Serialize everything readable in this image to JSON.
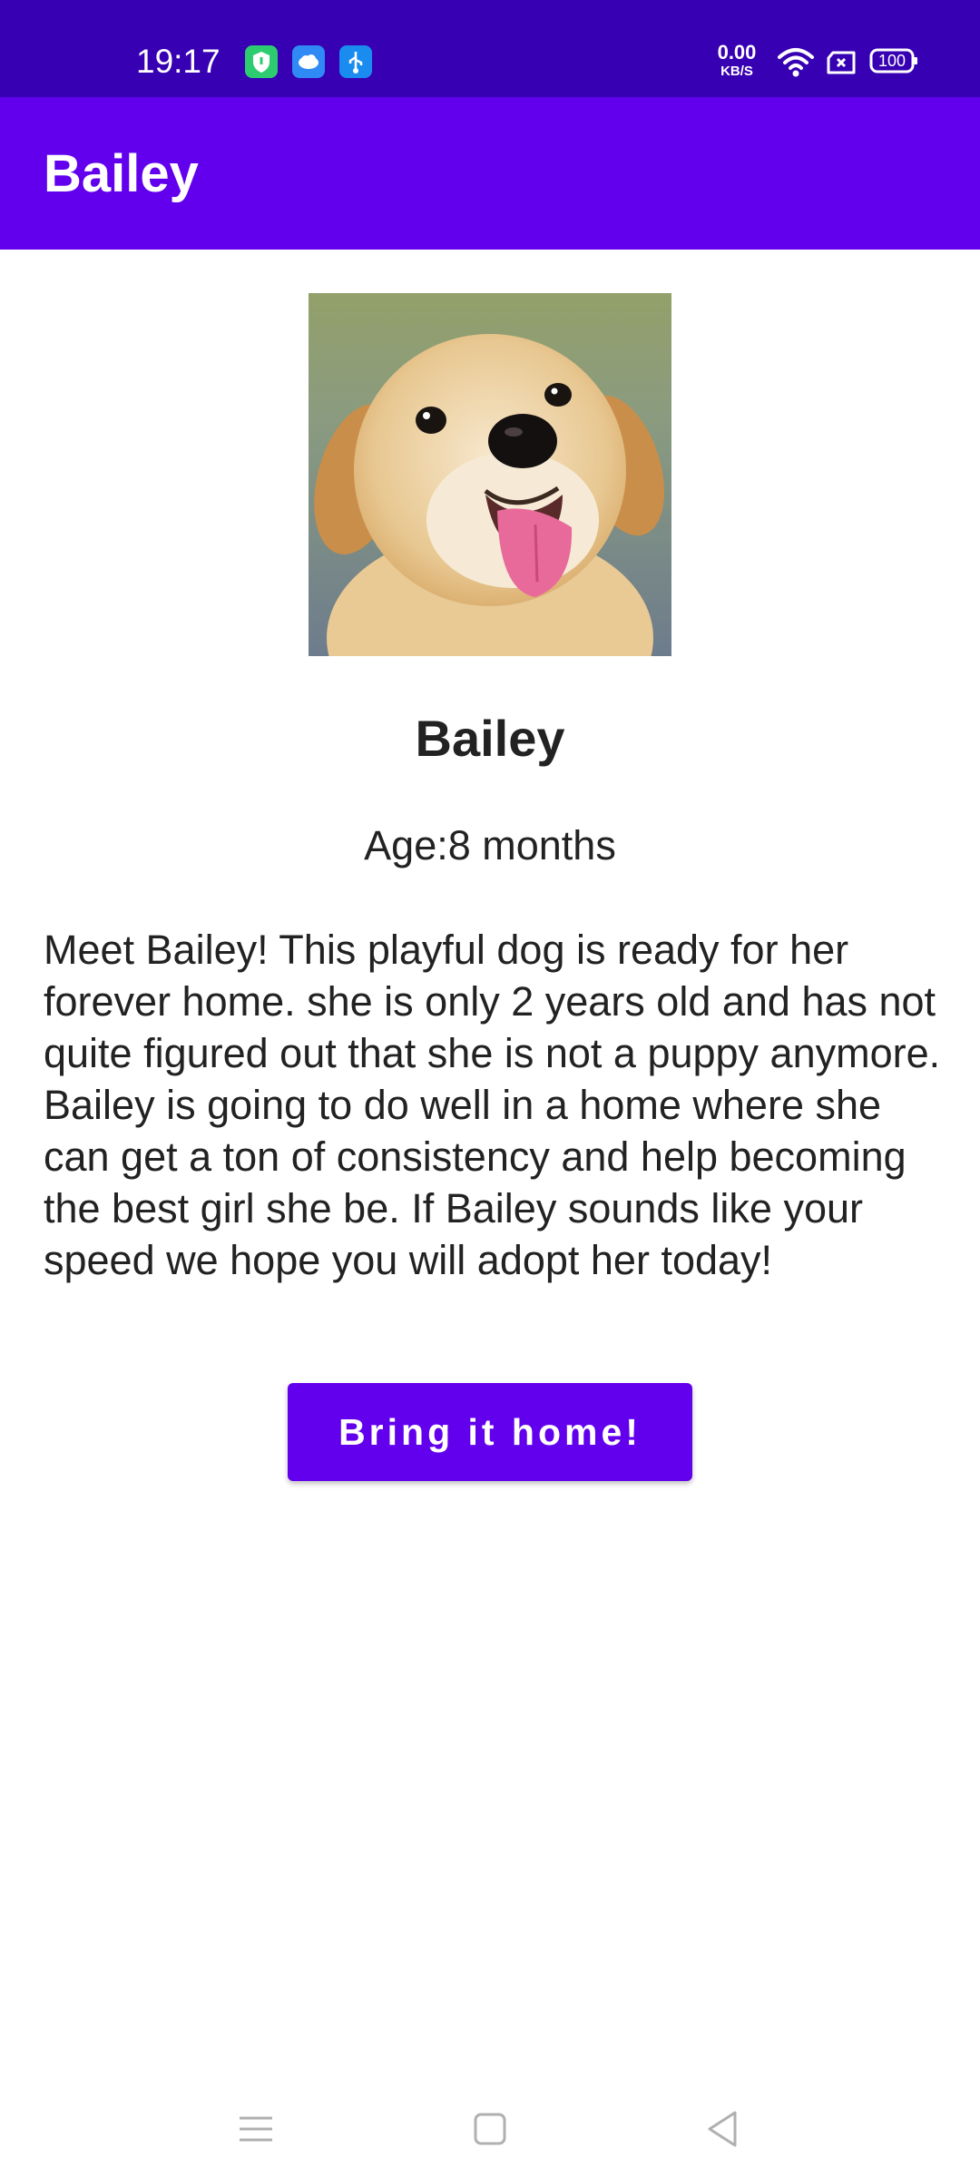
{
  "status_bar": {
    "time": "19:17",
    "net_speed_value": "0.00",
    "net_speed_unit": "KB/S",
    "battery": "100",
    "notification_icons": [
      "shield-icon",
      "cloud-icon",
      "usb-icon"
    ]
  },
  "app_bar": {
    "title": "Bailey"
  },
  "pet": {
    "photo_icon": "puppy-photo",
    "name": "Bailey",
    "age": "Age:8 months",
    "description": "Meet Bailey! This playful dog is ready for her forever home. she is only 2 years old and has not quite figured out that she is not a puppy anymore. Bailey is going to do well in a home where she can get a ton of consistency and help becoming the best girl she be. If Bailey sounds like your speed we hope you will adopt her today!"
  },
  "actions": {
    "adopt_label": "Bring it home!"
  },
  "nav_bar": {
    "icons": [
      "menu-icon",
      "home-icon",
      "back-icon"
    ]
  },
  "colors": {
    "status_bar": "#3700b3",
    "primary": "#6200ee",
    "text": "#222222"
  }
}
